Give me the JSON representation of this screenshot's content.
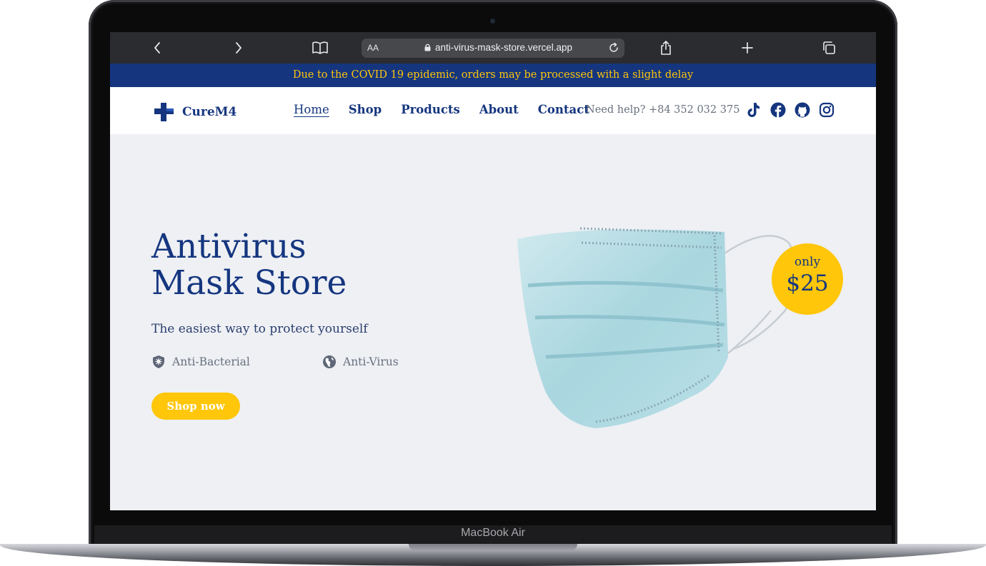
{
  "device": {
    "model_label": "MacBook Air"
  },
  "browser": {
    "reader_label": "AA",
    "url": "anti-virus-mask-store.vercel.app"
  },
  "announcement": "Due to the COVID 19 epidemic, orders may be processed with a slight delay",
  "header": {
    "brand": "CureM4",
    "nav": [
      "Home",
      "Shop",
      "Products",
      "About",
      "Contact"
    ],
    "active_nav": "Home",
    "help_text": "Need help? +84 352 032 375",
    "socials": [
      "tiktok-icon",
      "facebook-icon",
      "github-icon",
      "instagram-icon"
    ]
  },
  "hero": {
    "title_line1": "Antivirus",
    "title_line2": "Mask Store",
    "subtitle": "The easiest way to protect yourself",
    "features": [
      "Anti-Bacterial",
      "Anti-Virus"
    ],
    "cta": "Shop now",
    "price_prefix": "only",
    "price": "$25"
  },
  "colors": {
    "brand_navy": "#15367f",
    "accent_yellow": "#ffc60a",
    "hero_background": "#eef0f4"
  }
}
